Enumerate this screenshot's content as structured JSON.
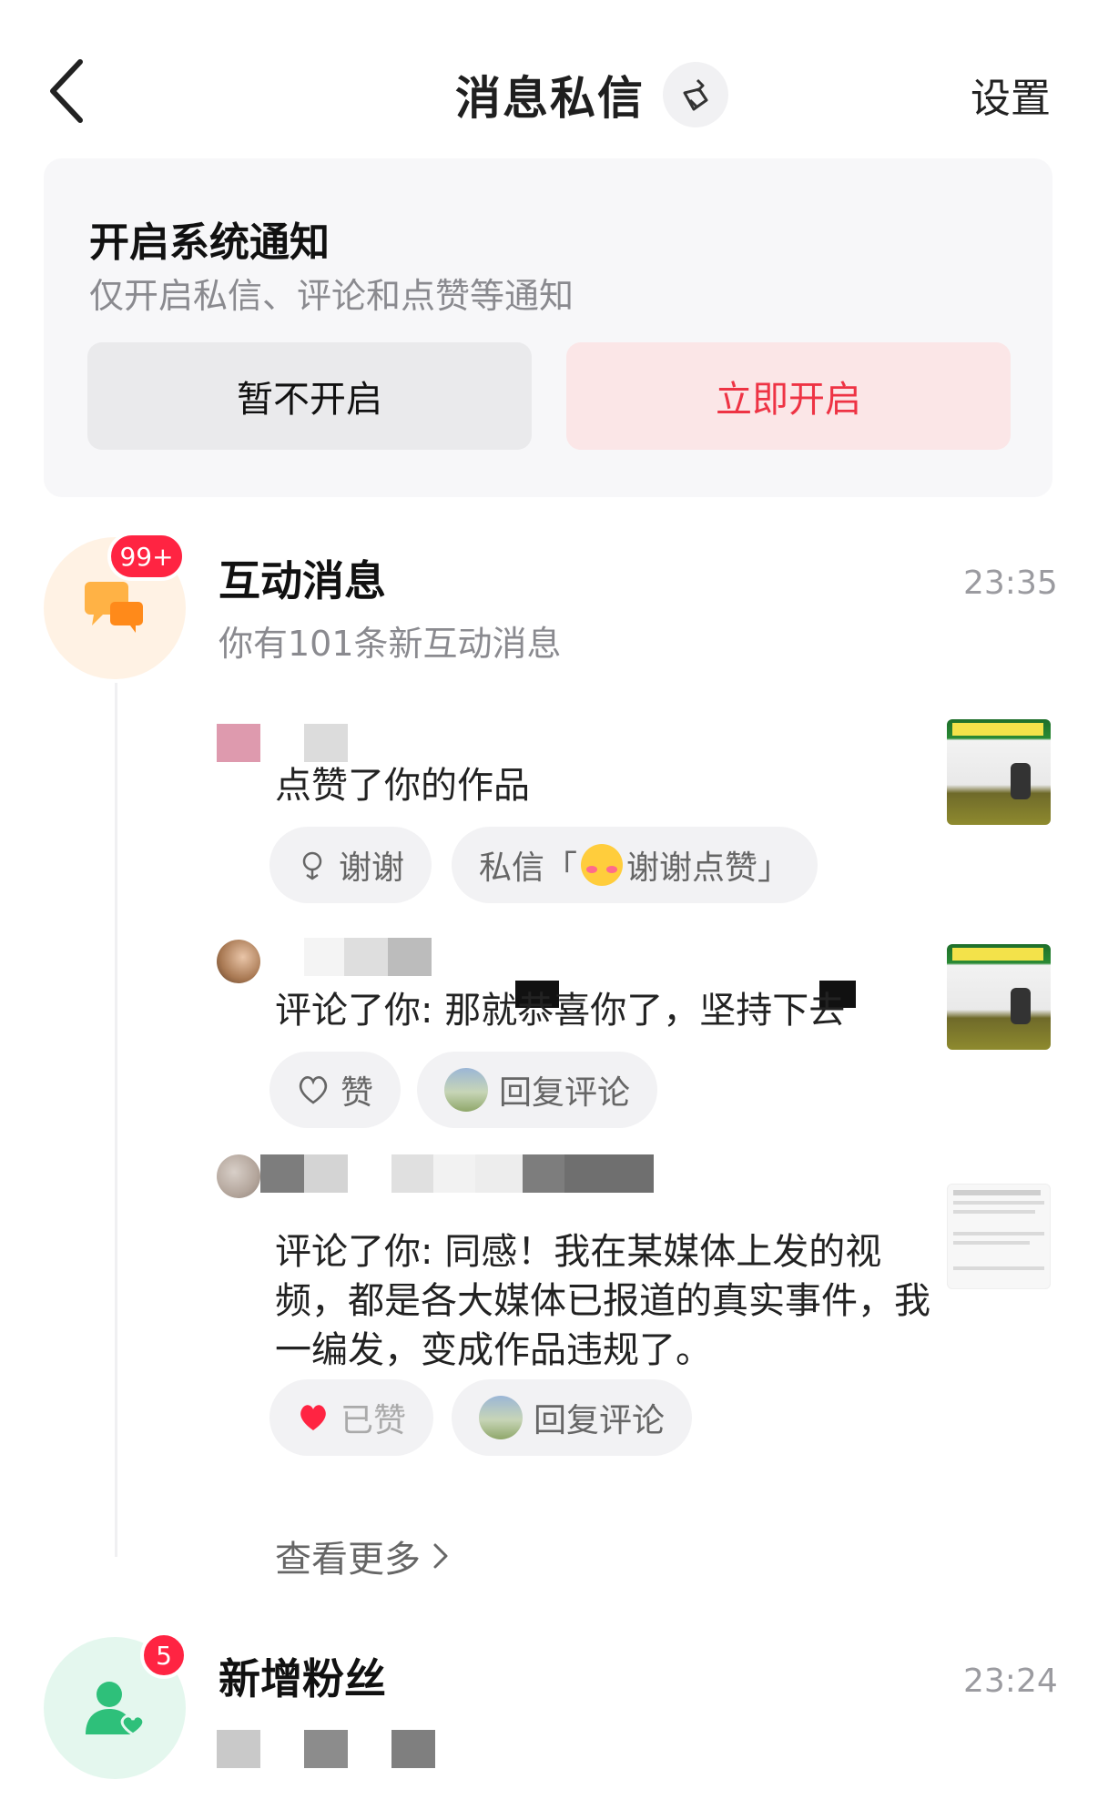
{
  "header": {
    "title": "消息私信",
    "settings": "设置"
  },
  "notify": {
    "title": "开启系统通知",
    "subtitle": "仅开启私信、评论和点赞等通知",
    "decline": "暂不开启",
    "accept": "立即开启"
  },
  "interactions": {
    "title": "互动消息",
    "subtitle": "你有101条新互动消息",
    "time": "23:35",
    "badge": "99+",
    "items": [
      {
        "text": "点赞了你的作品",
        "action1": "谢谢",
        "action2_prefix": "私信「",
        "action2_suffix": "谢谢点赞」"
      },
      {
        "text": "评论了你: 那就恭喜你了，坚持下去",
        "action1": "赞",
        "action2": "回复评论"
      },
      {
        "text": "评论了你: 同感！我在某媒体上发的视频，都是各大媒体已报道的真实事件，我一编发，变成作品违规了。",
        "action1": "已赞",
        "action2": "回复评论"
      }
    ],
    "more": "查看更多"
  },
  "followers": {
    "title": "新增粉丝",
    "time": "23:24",
    "badge": "5"
  },
  "colors": {
    "accent": "#ff2442",
    "accent_soft": "#fbe6e7",
    "orange": "#ffa62b",
    "green": "#2ec07a"
  }
}
